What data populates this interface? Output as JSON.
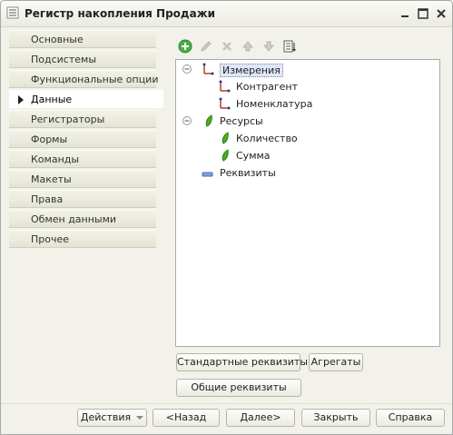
{
  "window": {
    "title": "Регистр накопления Продажи"
  },
  "sidebar": {
    "items": [
      {
        "label": "Основные"
      },
      {
        "label": "Подсистемы"
      },
      {
        "label": "Функциональные опции"
      },
      {
        "label": "Данные",
        "active": true
      },
      {
        "label": "Регистраторы"
      },
      {
        "label": "Формы"
      },
      {
        "label": "Команды"
      },
      {
        "label": "Макеты"
      },
      {
        "label": "Права"
      },
      {
        "label": "Обмен данными"
      },
      {
        "label": "Прочее"
      }
    ]
  },
  "toolbar": {
    "icons": [
      "add-icon",
      "edit-icon",
      "delete-icon",
      "move-up-icon",
      "move-down-icon",
      "sort-icon"
    ]
  },
  "tree": {
    "measurements": {
      "label": "Измерения",
      "children": [
        "Контрагент",
        "Номенклатура"
      ]
    },
    "resources": {
      "label": "Ресурсы",
      "children": [
        "Количество",
        "Сумма"
      ]
    },
    "attributes": {
      "label": "Реквизиты"
    }
  },
  "buttons": {
    "standard_attributes": "Стандартные реквизиты",
    "aggregates": "Агрегаты",
    "common_attributes": "Общие реквизиты"
  },
  "footer": {
    "actions": "Действия",
    "back": "<Назад",
    "next": "Далее>",
    "close": "Закрыть",
    "help": "Справка"
  },
  "colors": {
    "selection": "#e1e6ff",
    "resource_icon": "#4caf1a",
    "dimension_icon": "#c0392b",
    "add_icon": "#3aa63a"
  }
}
